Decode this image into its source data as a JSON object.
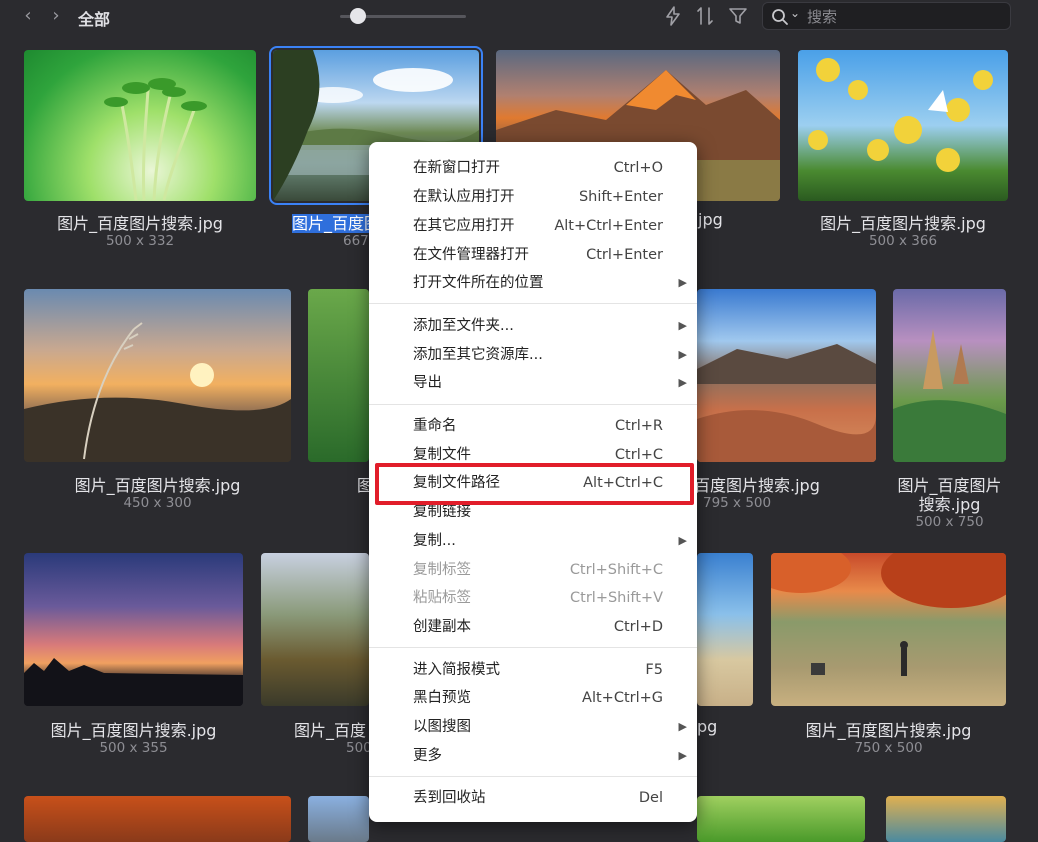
{
  "toolbar": {
    "breadcrumb": "全部",
    "search_placeholder": "搜索",
    "icons": [
      "back-icon",
      "forward-icon",
      "lightning-icon",
      "sort-icon",
      "filter-icon",
      "search-icon"
    ]
  },
  "grid": [
    {
      "name": "图片_百度图片搜索.jpg",
      "size": "500 x 332"
    },
    {
      "name": "图片_百度图",
      "size": "667"
    },
    {
      "name": "jpg",
      "size": ""
    },
    {
      "name": "图片_百度图片搜索.jpg",
      "size": "500 x 366"
    },
    {
      "name": "图片_百度图片搜索.jpg",
      "size": "450 x 300"
    },
    {
      "name": "图",
      "size": ""
    },
    {
      "name": "百度图片搜索.jpg",
      "size": "795 x 500"
    },
    {
      "name": "图片_百度图片",
      "name2": "搜索.jpg",
      "size": "500 x 750"
    },
    {
      "name": "图片_百度图片搜索.jpg",
      "size": "500 x 355"
    },
    {
      "name": "图片_百度",
      "size": "500"
    },
    {
      "name": "pg",
      "size": ""
    },
    {
      "name": "图片_百度图片搜索.jpg",
      "size": "750 x 500"
    }
  ],
  "menu": {
    "items": [
      {
        "label": "在新窗口打开",
        "shortcut": "Ctrl+O"
      },
      {
        "label": "在默认应用打开",
        "shortcut": "Shift+Enter"
      },
      {
        "label": "在其它应用打开",
        "shortcut": "Alt+Ctrl+Enter"
      },
      {
        "label": "在文件管理器打开",
        "shortcut": "Ctrl+Enter"
      },
      {
        "label": "打开文件所在的位置",
        "shortcut": ""
      },
      {
        "label": "添加至文件夹...",
        "shortcut": ""
      },
      {
        "label": "添加至其它资源库...",
        "shortcut": ""
      },
      {
        "label": "导出",
        "shortcut": ""
      },
      {
        "label": "重命名",
        "shortcut": "Ctrl+R"
      },
      {
        "label": "复制文件",
        "shortcut": "Ctrl+C"
      },
      {
        "label": "复制文件路径",
        "shortcut": "Alt+Ctrl+C"
      },
      {
        "label": "复制链接",
        "shortcut": ""
      },
      {
        "label": "复制...",
        "shortcut": ""
      },
      {
        "label": "复制标签",
        "shortcut": "Ctrl+Shift+C"
      },
      {
        "label": "粘贴标签",
        "shortcut": "Ctrl+Shift+V"
      },
      {
        "label": "创建副本",
        "shortcut": "Ctrl+D"
      },
      {
        "label": "进入简报模式",
        "shortcut": "F5"
      },
      {
        "label": "黑白预览",
        "shortcut": "Alt+Ctrl+G"
      },
      {
        "label": "以图搜图",
        "shortcut": ""
      },
      {
        "label": "更多",
        "shortcut": ""
      },
      {
        "label": "丢到回收站",
        "shortcut": "Del"
      }
    ],
    "highlighted": "复制文件路径"
  }
}
